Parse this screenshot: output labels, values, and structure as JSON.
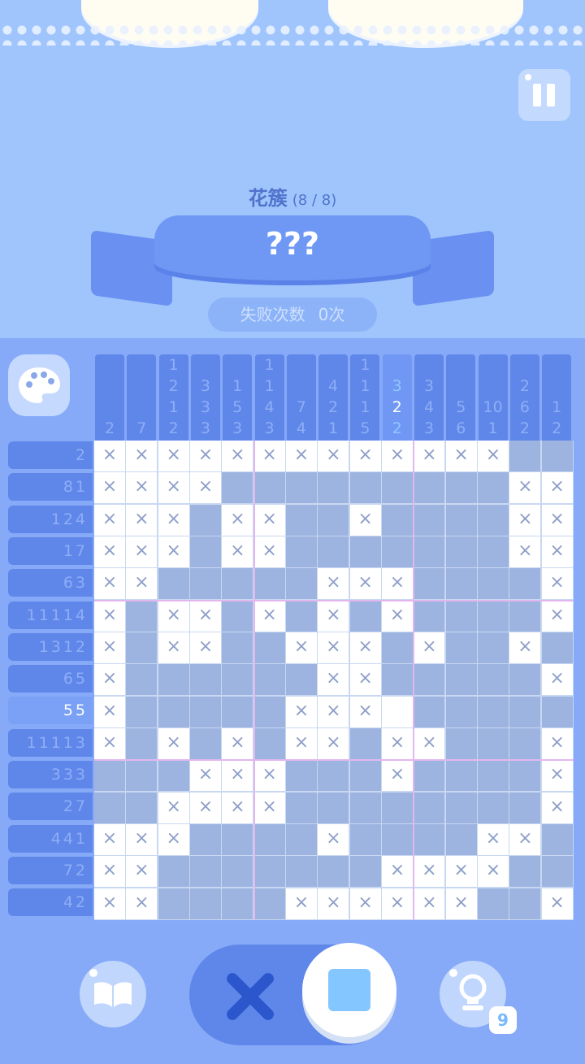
{
  "header": {
    "puzzle_name": "花簇",
    "progress": "(8 / 8)",
    "banner_title": "???",
    "fail_label": "失败次数",
    "fail_count": "0次"
  },
  "colors": {
    "background": "#9fc4fc",
    "clue_bg": "#5f87ea",
    "filled": "#9db3e0",
    "crossed": "#ffffff",
    "accent": "#84c6ff"
  },
  "column_clues": [
    [
      "2"
    ],
    [
      "7"
    ],
    [
      "1",
      "2",
      "1",
      "2"
    ],
    [
      "3",
      "3",
      "3"
    ],
    [
      "1",
      "5",
      "3"
    ],
    [
      "1",
      "1",
      "4",
      "3"
    ],
    [
      "7",
      "4"
    ],
    [
      "4",
      "2",
      "1"
    ],
    [
      "1",
      "1",
      "1",
      "5"
    ],
    [
      "3",
      "2",
      "2"
    ],
    [
      "3",
      "4",
      "3"
    ],
    [
      "5",
      "6"
    ],
    [
      "10",
      "1"
    ],
    [
      "2",
      "6",
      "2"
    ],
    [
      "1",
      "2"
    ]
  ],
  "active_column": 9,
  "row_clues": [
    "2",
    "81",
    "124",
    "17",
    "63",
    "11114",
    "1312",
    "65",
    "55",
    "11113",
    "333",
    "27",
    "441",
    "72",
    "42"
  ],
  "active_row": 8,
  "grid": [
    "xxxxxxxxxxxxxff",
    "xxxxfffffffffxx",
    "xxxfxxffxffffxx",
    "xxxfxxfffffffxx",
    "xxfffffxxxffffx",
    "xfxxfxfxfxffffx",
    "xfxxffxxxfxffx",
    "xffffffxxfffffx",
    "xfffffxxxbfffffx",
    "xfxfxfxxfxxfffx",
    "fffxxxfffxffffxx",
    "ffxxxxffffffffxx",
    "xxxffffxffffxxf",
    "xxfffffffxxxxff",
    "xxffffxxxxxxffx"
  ],
  "toolbar": {
    "guide_icon": "book-icon",
    "mode_cross_icon": "cross-icon",
    "mode_fill_icon": "fill-square-icon",
    "hint_icon": "lightbulb-icon",
    "hint_count": "9"
  }
}
